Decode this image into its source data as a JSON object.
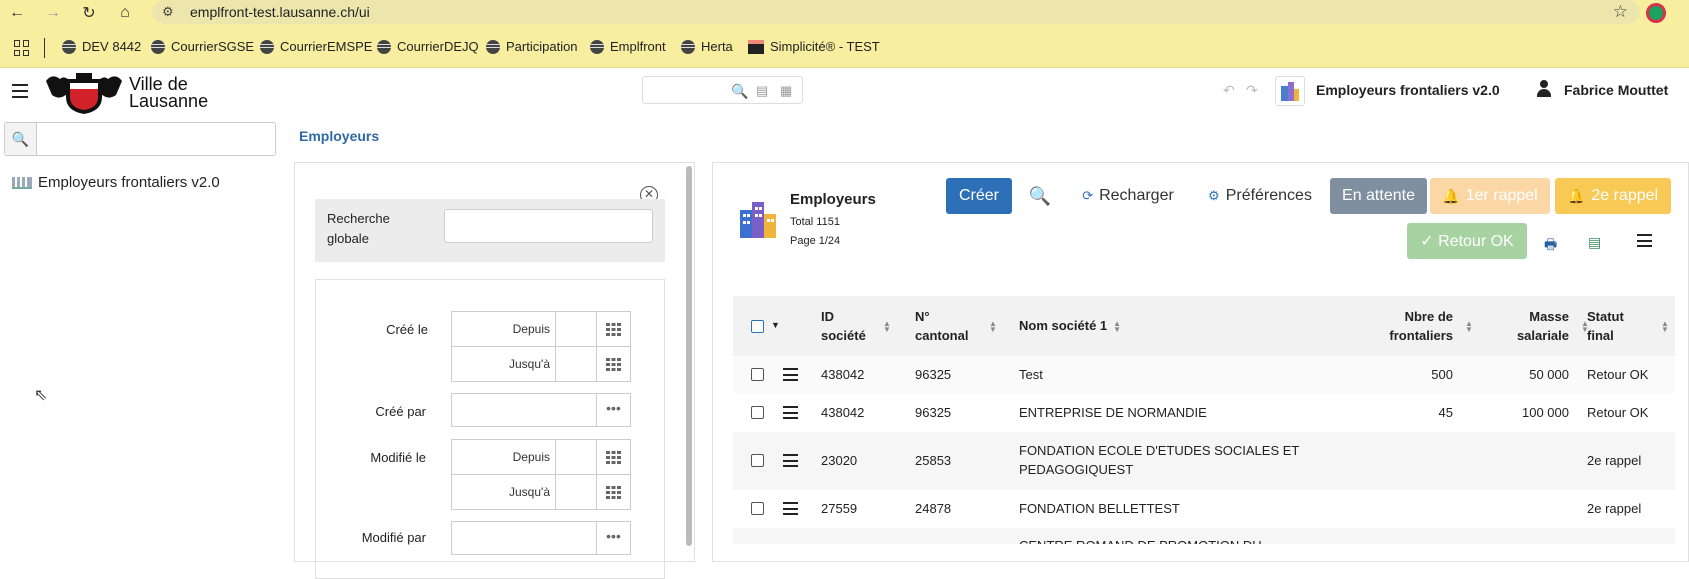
{
  "browser": {
    "url": "emplfront-test.lausanne.ch/ui",
    "bookmarks": [
      "DEV 8442",
      "CourrierSGSE",
      "CourrierEMSPE",
      "CourrierDEJQ",
      "Participation",
      "Emplfront",
      "Herta",
      "Simplicité® - TEST"
    ]
  },
  "header": {
    "logo_text_line1": "Ville de",
    "logo_text_line2": "Lausanne",
    "app_name": "Employeurs frontaliers v2.0",
    "user_name": "Fabrice Mouttet"
  },
  "sidebar": {
    "search_placeholder": "",
    "items": [
      {
        "label": "Employeurs frontaliers v2.0",
        "icon": "building-icon"
      }
    ]
  },
  "breadcrumb": "Employeurs",
  "filters": {
    "global_label": "Recherche globale",
    "created_label": "Créé le",
    "from_placeholder": "Depuis",
    "to_placeholder": "Jusqu'à",
    "created_by_label": "Créé par",
    "modified_label": "Modifié le",
    "modified_by_label": "Modifié par"
  },
  "list": {
    "title": "Employeurs",
    "total": "Total 1151",
    "page": "Page 1/24",
    "buttons": {
      "create": "Créer",
      "reload": "Recharger",
      "preferences": "Préférences",
      "pending": "En attente",
      "reminder1": "1er rappel",
      "reminder2": "2e rappel",
      "return_ok": "✓ Retour OK"
    },
    "colors": {
      "create": "#2e70b8",
      "pending": "#7f8fa0",
      "reminder1": "#fbd7a6",
      "reminder2": "#f9c955",
      "return_ok": "#a7d3a2"
    },
    "columns": {
      "id_line1": "ID",
      "id_line2": "société",
      "canton_line1": "N°",
      "canton_line2": "cantonal",
      "name": "Nom société 1",
      "count_line1": "Nbre de",
      "count_line2": "frontaliers",
      "mass_line1": "Masse",
      "mass_line2": "salariale",
      "status_line1": "Statut",
      "status_line2": "final"
    },
    "rows": [
      {
        "id": "438042",
        "canton": "96325",
        "name": "Test",
        "count": "500",
        "mass": "50 000",
        "status": "Retour OK"
      },
      {
        "id": "438042",
        "canton": "96325",
        "name": "ENTREPRISE DE NORMANDIE",
        "count": "45",
        "mass": "100 000",
        "status": "Retour OK"
      },
      {
        "id": "23020",
        "canton": "25853",
        "name": "FONDATION ECOLE D'ETUDES SOCIALES ET",
        "name2": "PEDAGOGIQUEST",
        "count": "",
        "mass": "",
        "status": "2e rappel"
      },
      {
        "id": "27559",
        "canton": "24878",
        "name": "FONDATION BELLETTEST",
        "count": "",
        "mass": "",
        "status": "2e rappel"
      }
    ],
    "partial_row_text": "CENTRE ROMAND DE PROMOTION DU"
  }
}
